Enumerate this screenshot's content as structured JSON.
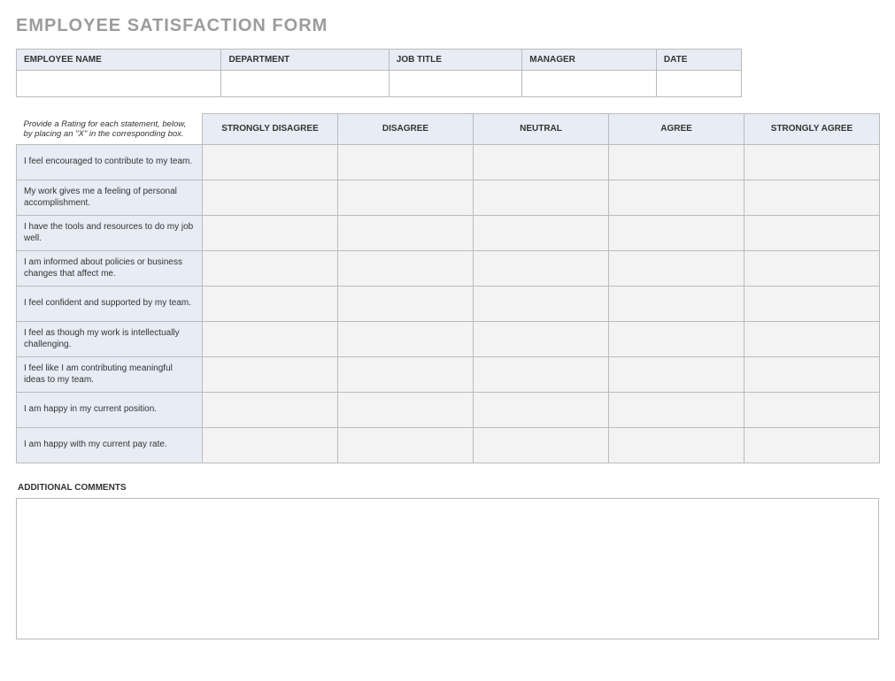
{
  "title": "EMPLOYEE SATISFACTION FORM",
  "info_headers": [
    "EMPLOYEE NAME",
    "DEPARTMENT",
    "JOB TITLE",
    "MANAGER",
    "DATE"
  ],
  "info_values": [
    "",
    "",
    "",
    "",
    ""
  ],
  "instructions": "Provide a Rating for each statement, below, by placing an \"X\" in the corresponding box.",
  "rating_columns": [
    "STRONGLY DISAGREE",
    "DISAGREE",
    "NEUTRAL",
    "AGREE",
    "STRONGLY AGREE"
  ],
  "statements": [
    "I feel encouraged to contribute to my team.",
    "My work gives me a feeling of personal accomplishment.",
    "I have the tools and resources to do my job well.",
    "I am informed about policies or business changes that affect me.",
    "I feel confident and supported by my team.",
    "I feel as though my work is intellectually challenging.",
    "I feel like I am contributing meaningful ideas to my team.",
    "I am happy in my current position.",
    "I am happy with my current pay rate."
  ],
  "comments_label": "ADDITIONAL COMMENTS",
  "comments_value": ""
}
